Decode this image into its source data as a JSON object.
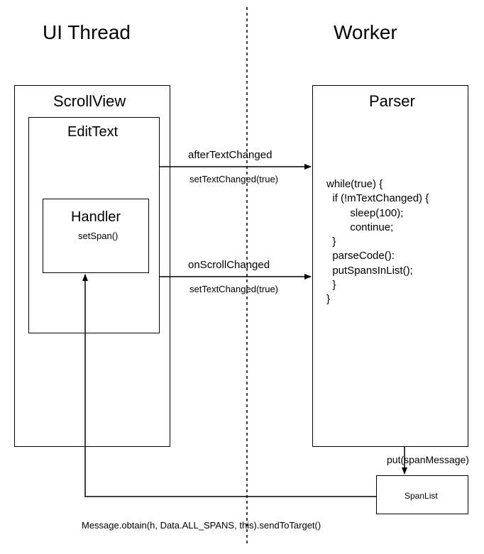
{
  "headings": {
    "ui_thread": "UI Thread",
    "worker": "Worker"
  },
  "boxes": {
    "scrollview": "ScrollView",
    "edittext": "EditText",
    "handler": "Handler",
    "handler_sub": "setSpan()",
    "parser": "Parser",
    "spanlist": "SpanList"
  },
  "parser_code": "while(true) {\n  if (!mTextChanged) {\n        sleep(100);\n        continue;\n  }\n  parseCode():\n  putSpansInList();\n  }\n}",
  "arrows": {
    "arrow1_label1": "afterTextChanged",
    "arrow1_label2": "setTextChanged(true)",
    "arrow2_label1": "onScrollChanged",
    "arrow2_label2": "setTextChanged(true)",
    "arrow3_label": "put(spanMessage)",
    "arrow4_label": "Message.obtain(h, Data.ALL_SPANS, this).sendToTarget()"
  }
}
